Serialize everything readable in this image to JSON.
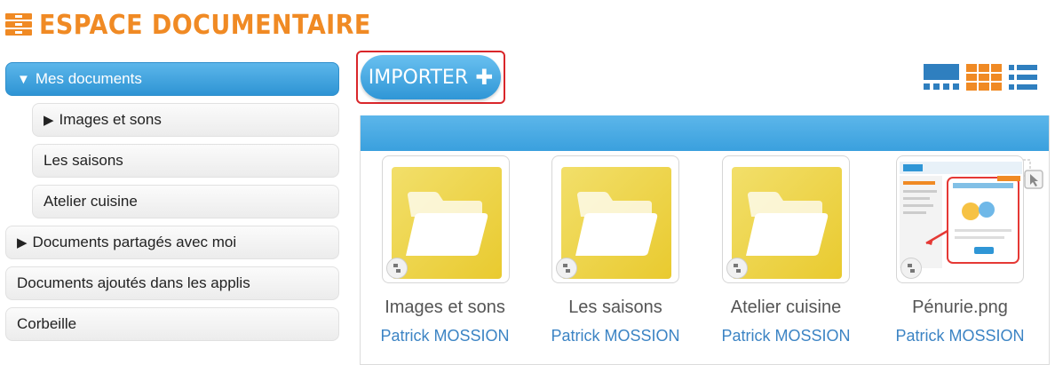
{
  "header": {
    "title": "ESPACE DOCUMENTAIRE",
    "logo_icon": "drawers-icon"
  },
  "sidebar": {
    "items": [
      {
        "label": "Mes documents",
        "arrow": "▼"
      },
      {
        "label": "Images et sons",
        "arrow": "▶"
      },
      {
        "label": "Les saisons"
      },
      {
        "label": "Atelier cuisine"
      },
      {
        "label": "Documents partagés avec moi",
        "arrow": "▶"
      },
      {
        "label": "Documents ajoutés dans les applis"
      },
      {
        "label": "Corbeille"
      }
    ]
  },
  "toolbar": {
    "import_label": "IMPORTER",
    "import_plus": "✚",
    "views": [
      "carousel-view-icon",
      "grid-view-icon",
      "list-view-icon"
    ]
  },
  "colors": {
    "orange": "#f08a24",
    "blue": "#2f96d6",
    "folder": "#e9ca2f",
    "link": "#3c84c4"
  },
  "files": [
    {
      "name": "Images et sons",
      "owner": "Patrick MOSSION",
      "type": "folder"
    },
    {
      "name": "Les saisons",
      "owner": "Patrick MOSSION",
      "type": "folder"
    },
    {
      "name": "Atelier cuisine",
      "owner": "Patrick MOSSION",
      "type": "folder"
    },
    {
      "name": "Pénurie.png",
      "owner": "Patrick MOSSION",
      "type": "image"
    }
  ]
}
